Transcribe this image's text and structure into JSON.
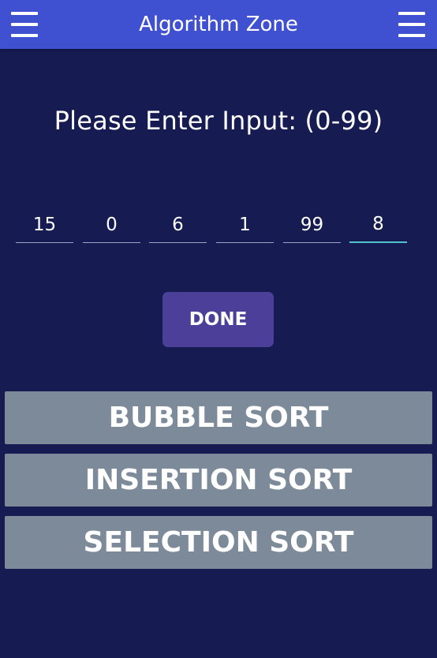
{
  "header": {
    "title": "Algorithm Zone",
    "left_icon": "menu-icon",
    "right_icon": "menu-icon"
  },
  "prompt": "Please Enter Input: (0-99)",
  "inputs": [
    {
      "value": "15"
    },
    {
      "value": "0"
    },
    {
      "value": "6"
    },
    {
      "value": "1"
    },
    {
      "value": "99"
    },
    {
      "value": "8"
    }
  ],
  "done_label": "DONE",
  "sort_buttons": [
    {
      "label": "BUBBLE SORT"
    },
    {
      "label": "INSERTION SORT"
    },
    {
      "label": "SELECTION SORT"
    }
  ],
  "colors": {
    "background": "#161b52",
    "app_bar": "#3f51d1",
    "done_button": "#4b3f9a",
    "sort_button": "#7d8a9a",
    "focus_accent": "#4fc3c9"
  }
}
